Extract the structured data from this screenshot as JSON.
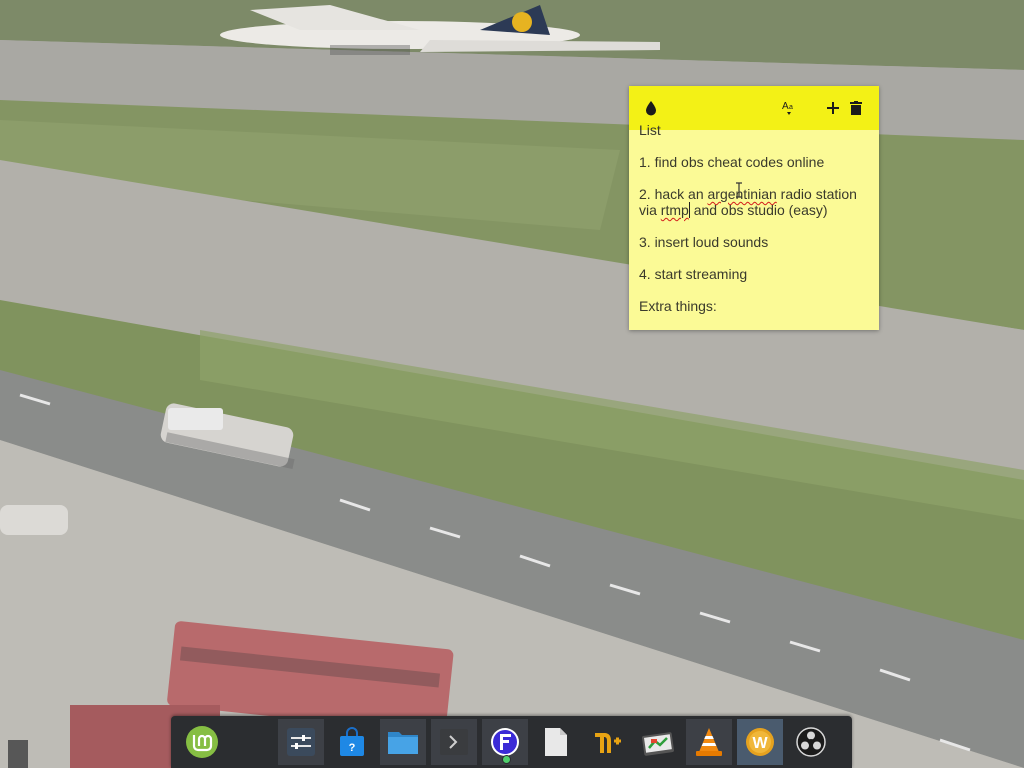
{
  "note": {
    "lines": [
      "List",
      "1. find obs cheat codes online",
      "2. hack an",
      "argentinian",
      "radio station via",
      "rtmp",
      "and obs studio (easy)",
      "3. insert loud sounds",
      "4. start streaming",
      "Extra things:"
    ],
    "header_icons": {
      "color": "droplet-icon",
      "font": "font-size-icon",
      "add": "plus-icon",
      "delete": "trash-icon"
    },
    "colors": {
      "header": "#f3f116",
      "body": "#fbfa96",
      "text": "#3a3a2c"
    }
  },
  "taskbar": {
    "items": [
      {
        "name": "linux-mint-menu",
        "icon": "mint-logo-icon"
      },
      {
        "name": "system-settings",
        "icon": "sliders-icon"
      },
      {
        "name": "software-store",
        "icon": "shopping-bag-icon"
      },
      {
        "name": "file-manager",
        "icon": "folder-icon"
      },
      {
        "name": "terminal",
        "icon": "terminal-icon"
      },
      {
        "name": "app-f",
        "icon": "letter-f-icon"
      },
      {
        "name": "text-editor",
        "icon": "document-icon"
      },
      {
        "name": "neptune-app",
        "icon": "neptune-icon"
      },
      {
        "name": "disk-usage",
        "icon": "disk-chart-icon"
      },
      {
        "name": "vlc-player",
        "icon": "vlc-cone-icon"
      },
      {
        "name": "app-w",
        "icon": "letter-w-icon"
      },
      {
        "name": "obs-studio",
        "icon": "obs-icon"
      }
    ],
    "colors": {
      "bar": "#2b2d30",
      "mint": "#86be43",
      "accent": "#4a5b6e"
    }
  }
}
